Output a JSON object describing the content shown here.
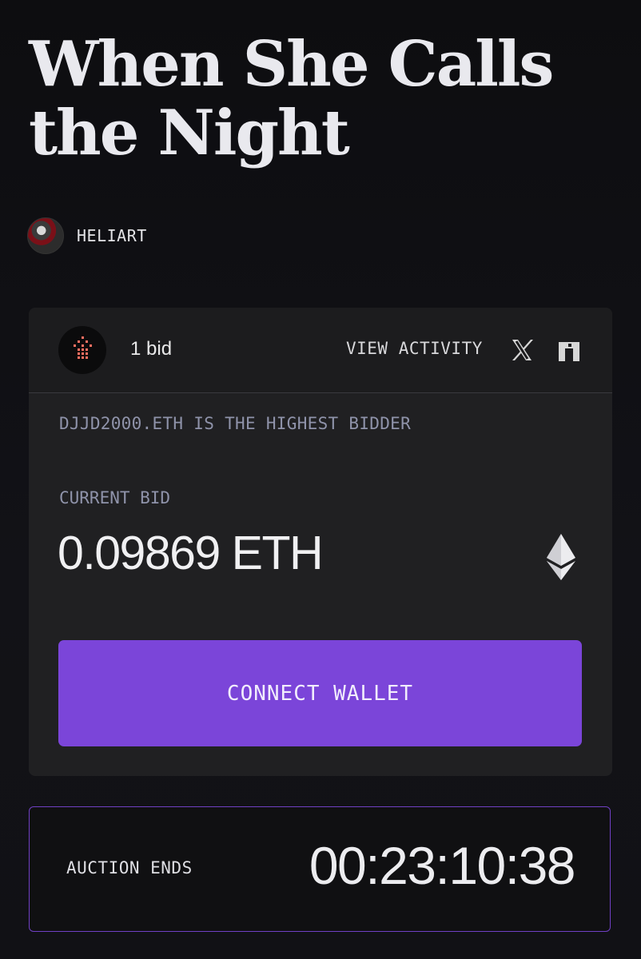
{
  "artwork": {
    "title": "When She Calls the Night",
    "artist_name": "HELIART"
  },
  "bid_panel": {
    "bid_count": "1 bid",
    "view_activity_label": "VIEW ACTIVITY",
    "highest_bidder_text": "DJJD2000.ETH IS THE HIGHEST BIDDER",
    "current_bid_label": "CURRENT BID",
    "current_bid_value": "0.09869 ETH",
    "connect_wallet_label": "CONNECT WALLET",
    "icons": {
      "collector": "pixel-face-icon",
      "x": "x-logo-icon",
      "link": "external-link-icon",
      "currency": "ethereum-icon"
    }
  },
  "auction": {
    "label": "AUCTION ENDS",
    "time_remaining": "00:23:10:38"
  },
  "colors": {
    "background": "#0f0f12",
    "card": "#202022",
    "accent_purple": "#7b45d9",
    "muted_text": "#8f93aa",
    "pixel_icon": "#ff6f61"
  }
}
